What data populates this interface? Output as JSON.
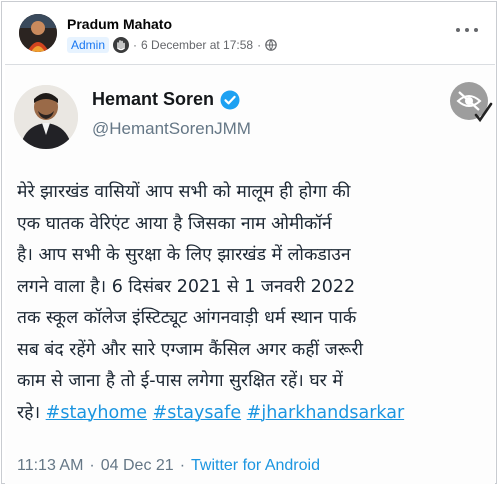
{
  "post": {
    "author": "Pradum Mahato",
    "role_badge": "Admin",
    "dot_separator": "·",
    "timestamp": "6 December at 17:58",
    "dot_separator2": "·",
    "badge_icon": "hand-wave-icon",
    "privacy_icon": "globe-icon",
    "menu_icon": "more-options-icon"
  },
  "tweet": {
    "name": "Hemant Soren",
    "handle": "@HemantSorenJMM",
    "verified_icon": "verified-check-icon",
    "hide_icon": "eye-slash-icon",
    "lines": [
      "मेरे झारखंड वासियों आप सभी को मालूम ही होगा की",
      "एक घातक वेरिएंट आया है जिसका नाम ओमीकॉर्न",
      "है। आप सभी के सुरक्षा के लिए झारखंड में लोकडाउन",
      "लगने वाला है। 6 दिसंबर 2021 से 1 जनवरी 2022",
      "तक स्कूल कॉलेज इंस्टिट्यूट आंगनवाड़ी धर्म स्थान पार्क",
      "सब बंद रहेंगे और सारे एग्जाम कैंसिल अगर कहीं जरूरी",
      "काम से जाना है तो ई-पास लगेगा सुरक्षित रहें। घर में"
    ],
    "last_line_prefix": "रहे।",
    "hashtags": [
      "#stayhome",
      "#staysafe",
      "#jharkhandsarkar"
    ],
    "time": "11:13 AM",
    "sep1": "·",
    "date": "04 Dec 21",
    "sep2": "·",
    "source": "Twitter for Android"
  },
  "colors": {
    "facebook_blue": "#1877f2",
    "twitter_blue": "#1b95e0",
    "text_dark": "#14171a",
    "muted": "#657786"
  }
}
